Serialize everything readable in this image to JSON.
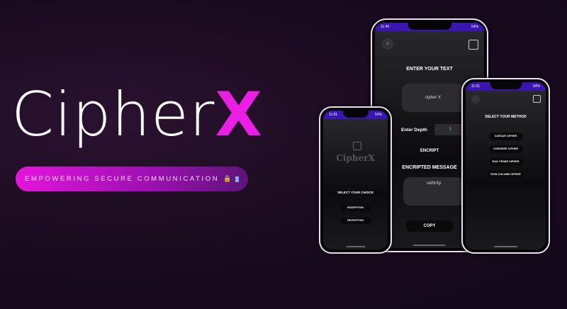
{
  "brand": {
    "title_main": "Cipher",
    "title_accent": "X",
    "tagline": "EMPOWERING SECURE COMMUNICATION",
    "tagline_emoji": "🔒"
  },
  "colors": {
    "accent": "#ec1ee6",
    "status_bar": "#3a16b0"
  },
  "phone_home": {
    "status_time": "11:01",
    "status_battery": "54%",
    "logo": "CipherX",
    "heading": "SELECT YOUR CHOICE",
    "buttons": [
      "ENCRYPTION",
      "DECRYPTION"
    ]
  },
  "phone_encrypt": {
    "status_time": "11:40",
    "status_battery": "54%",
    "back": "<",
    "heading": "ENTER YOUR TEXT",
    "input_value": "cipher X",
    "depth_label": "Enter Depth",
    "depth_value": "3",
    "encrypt_button": "ENCRIPT",
    "result_heading": "ENCRIPTED MESSAGE",
    "result_value": "ceihrXp",
    "copy_button": "COPY"
  },
  "phone_method": {
    "status_time": "11:01",
    "status_battery": "54%",
    "heading": "SELECT YOUR METHOD",
    "methods": [
      "CAESAR CIPHER",
      "VIGENERE CIPHER",
      "RAIL FENSE CIPHER",
      "ROW COLUMN CIPHER"
    ]
  }
}
